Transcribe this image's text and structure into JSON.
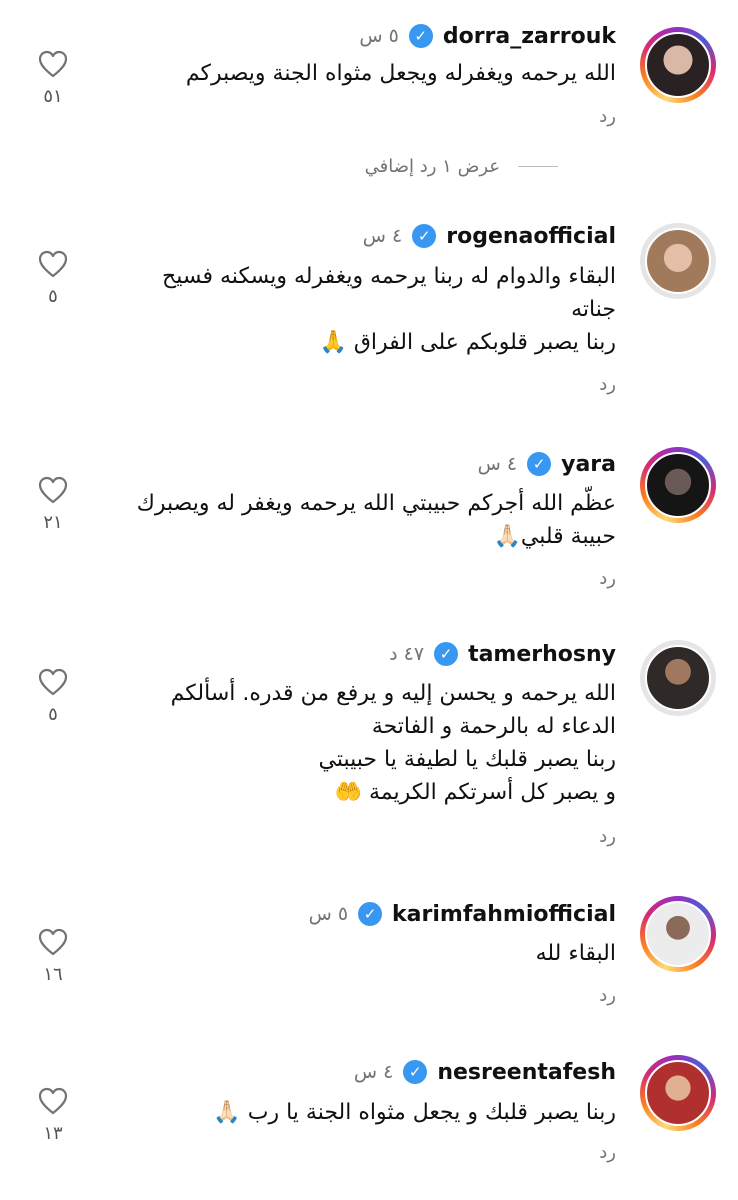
{
  "comments": [
    {
      "username": "dorra_zarrouk",
      "time": "٥ س",
      "lines": [
        "الله يرحمه ويغفرله ويجعل مثواه الجنة ويصبركم"
      ],
      "reply": "رد",
      "likes": "٥١",
      "avatar_color": "#3a3232"
    },
    {
      "username": "rogenaofficial",
      "time": "٤ س",
      "lines": [
        "البقاء والدوام له ربنا يرحمه ويغفرله ويسكنه فسيح",
        "جناته",
        "ربنا يصبر قلوبكم على الفراق 🙏"
      ],
      "reply": "رد",
      "likes": "٥",
      "avatar_color": "#c9a08a"
    },
    {
      "username": "yara",
      "time": "٤ س",
      "lines": [
        "عظّم الله أجركم حبيبتي الله يرحمه ويغفر له ويصبرك",
        "حبيبة قلبي🙏🏻"
      ],
      "reply": "رد",
      "likes": "٢١",
      "avatar_color": "#2b2b2b"
    },
    {
      "username": "tamerhosny",
      "time": "٤٧ د",
      "lines": [
        "الله يرحمه و يحسن إليه و يرفع من قدره. أسألكم",
        "الدعاء له بالرحمة و الفاتحة",
        "ربنا يصبر قلبك يا لطيفة يا حبيبتي",
        "و يصبر كل أسرتكم الكريمة 🤲"
      ],
      "reply": "رد",
      "likes": "٥",
      "avatar_color": "#3d3a38"
    },
    {
      "username": "karimfahmiofficial",
      "time": "٥ س",
      "lines": [
        "البقاء لله"
      ],
      "reply": "رد",
      "likes": "١٦",
      "avatar_color": "#d8d8d8"
    },
    {
      "username": "nesreentafesh",
      "time": "٤ س",
      "lines": [
        "ربنا يصبر قلبك و يجعل مثواه الجنة يا رب 🙏🏻"
      ],
      "reply": "رد",
      "likes": "١٣",
      "avatar_color": "#c0392b"
    }
  ],
  "view_replies": "عرض ١ رد إضافي",
  "icons": {
    "verified": "verified-check-icon",
    "like": "heart-outline-icon"
  },
  "colors": {
    "verified": "#3897f0",
    "secondary_text": "#737373"
  }
}
